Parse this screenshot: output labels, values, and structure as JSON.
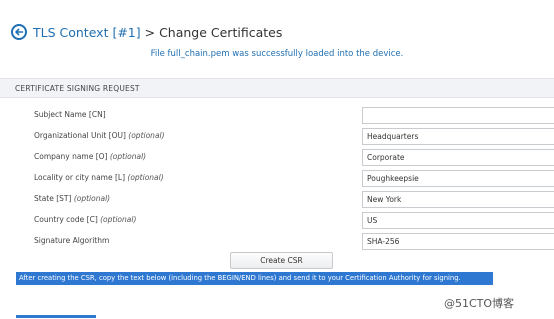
{
  "header": {
    "context_link": "TLS Context [#1]",
    "separator": " > ",
    "page_title": "Change Certificates"
  },
  "notice": "File  full_chain.pem  was successfully loaded into the device.",
  "section_title": "CERTIFICATE SIGNING REQUEST",
  "fields": [
    {
      "label": "Subject Name [CN]",
      "optional": "",
      "value": ""
    },
    {
      "label": "Organizational Unit [OU] ",
      "optional": "(optional)",
      "value": "Headquarters"
    },
    {
      "label": "Company name [O] ",
      "optional": "(optional)",
      "value": "Corporate"
    },
    {
      "label": "Locality or city name [L] ",
      "optional": "(optional)",
      "value": "Poughkeepsie"
    },
    {
      "label": "State [ST] ",
      "optional": "(optional)",
      "value": "New York"
    },
    {
      "label": "Country code [C] ",
      "optional": "(optional)",
      "value": "US"
    },
    {
      "label": "Signature Algorithm",
      "optional": "",
      "value": "SHA-256"
    }
  ],
  "create_csr_label": "Create CSR",
  "info_text": "After creating the CSR, copy the text below (including the BEGIN/END lines) and send it to your Certification Authority for signing.",
  "watermark": "@51CTO博客",
  "colors": {
    "accent": "#1f6fb2",
    "highlight": "#2e78d2"
  }
}
